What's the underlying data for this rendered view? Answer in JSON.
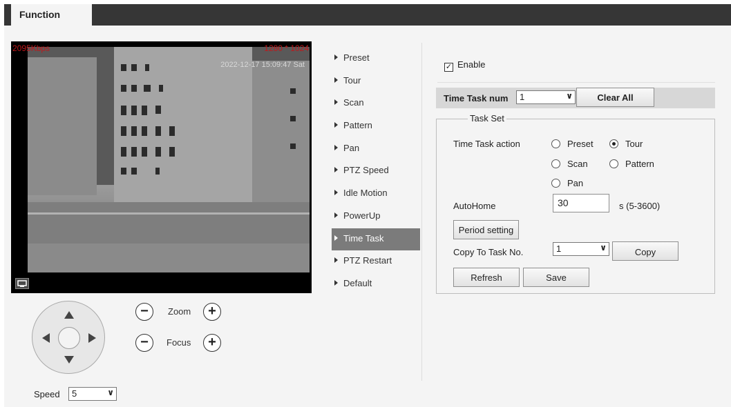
{
  "header": {
    "tab_function": "Function"
  },
  "video": {
    "bitrate": "2095Kbps",
    "resolution": "1280 * 1024",
    "timestamp": "2022-12-17 15:09:47 Sat"
  },
  "ptz": {
    "zoom_label": "Zoom",
    "focus_label": "Focus",
    "minus_symbol": "−",
    "plus_symbol": "+",
    "speed_label": "Speed",
    "speed_value": "5"
  },
  "menu": {
    "items": [
      {
        "label": "Preset"
      },
      {
        "label": "Tour"
      },
      {
        "label": "Scan"
      },
      {
        "label": "Pattern"
      },
      {
        "label": "Pan"
      },
      {
        "label": "PTZ Speed"
      },
      {
        "label": "Idle Motion"
      },
      {
        "label": "PowerUp"
      },
      {
        "label": "Time Task"
      },
      {
        "label": "PTZ Restart"
      },
      {
        "label": "Default"
      }
    ],
    "active_index": 8
  },
  "settings": {
    "enable_label": "Enable",
    "enable_checked": true,
    "time_task_num_label": "Time Task num",
    "time_task_num_value": "1",
    "clear_all_label": "Clear All",
    "task_set_legend": "Task Set",
    "time_task_action_label": "Time Task action",
    "actions": [
      {
        "label": "Preset",
        "selected": false
      },
      {
        "label": "Tour",
        "selected": true
      },
      {
        "label": "Scan",
        "selected": false
      },
      {
        "label": "Pattern",
        "selected": false
      },
      {
        "label": "Pan",
        "selected": false
      }
    ],
    "autohome_label": "AutoHome",
    "autohome_value": "30",
    "autohome_unit": "s (5-3600)",
    "period_setting_label": "Period setting",
    "copy_to_task_label": "Copy To Task No.",
    "copy_to_task_value": "1",
    "copy_label": "Copy",
    "refresh_label": "Refresh",
    "save_label": "Save"
  },
  "colors": {
    "topbar": "#363636",
    "active_menu": "#7b7b7b",
    "osd_text": "#c0181b"
  }
}
